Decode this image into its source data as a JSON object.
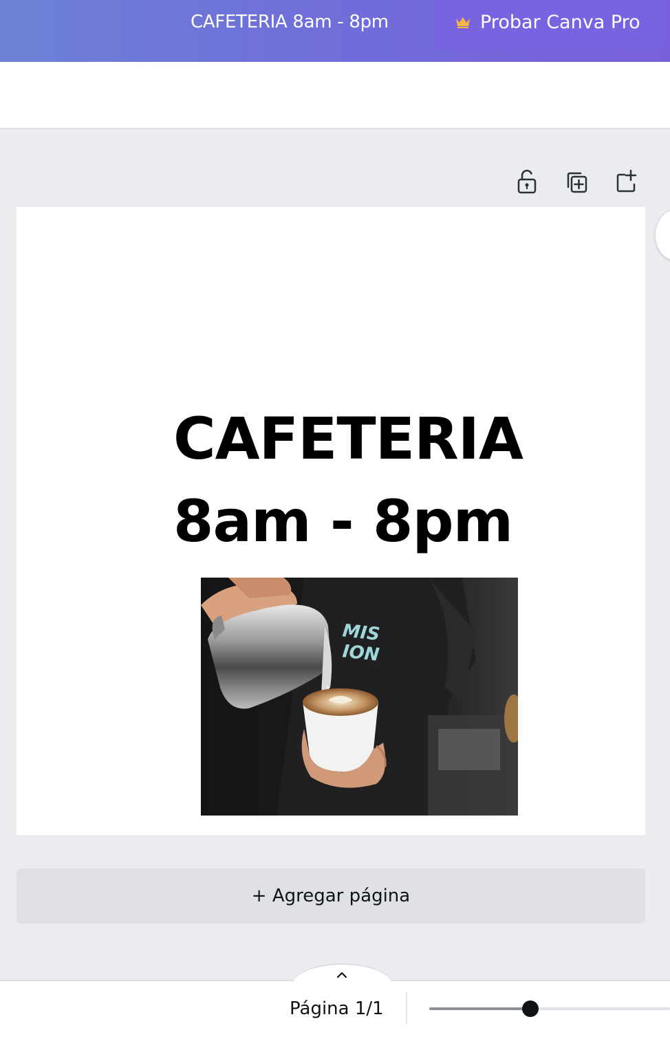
{
  "header": {
    "doc_title": "CAFETERIA 8am - 8pm",
    "pro_button_label": "Probar Canva Pro",
    "crown_icon": "crown-icon",
    "crown_color": "#f5b642"
  },
  "page_actions": {
    "icons": [
      "unlock-icon",
      "duplicate-page-icon",
      "add-page-icon"
    ]
  },
  "canvas": {
    "headline_line1": "CAFETERIA",
    "headline_line2": "8am - 8pm",
    "photo": "barista-latte-photo"
  },
  "add_page_label": "+ Agregar página",
  "footer": {
    "page_indicator": "Página 1/1",
    "expand_icon": "chevron-up-icon",
    "zoom_level": 0.42
  },
  "colors": {
    "accent": "#7a63e0",
    "canvas_bg": "#ebecf0"
  }
}
